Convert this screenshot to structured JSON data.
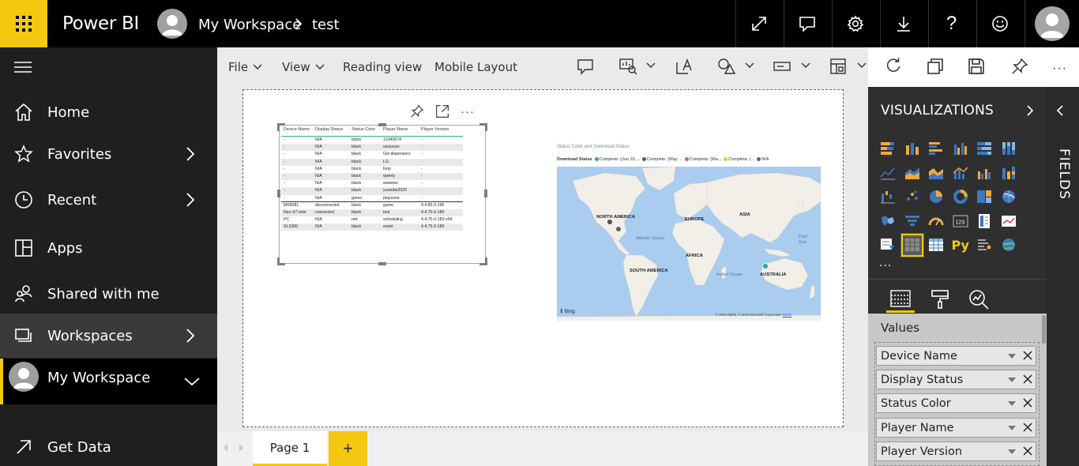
{
  "app": {
    "title": "Power BI",
    "accent": "#f2c811"
  },
  "breadcrumb": {
    "workspace": "My Workspace",
    "report": "test"
  },
  "header_icons": [
    "expand-icon",
    "comment-icon",
    "gear-icon",
    "download-icon",
    "help-icon",
    "smiley-icon",
    "user-avatar"
  ],
  "sidebar": {
    "items": [
      {
        "label": "Home",
        "icon": "home-icon"
      },
      {
        "label": "Favorites",
        "icon": "star-icon"
      },
      {
        "label": "Recent",
        "icon": "clock-icon"
      },
      {
        "label": "Apps",
        "icon": "apps-icon"
      },
      {
        "label": "Shared with me",
        "icon": "shared-icon"
      },
      {
        "label": "Workspaces",
        "icon": "workspaces-icon"
      },
      {
        "label": "My Workspace",
        "icon": "avatar"
      },
      {
        "label": "Get Data",
        "icon": "arrow-icon"
      }
    ]
  },
  "toolbar": {
    "file": "File",
    "view": "View",
    "reading_view": "Reading view",
    "mobile_layout": "Mobile Layout"
  },
  "table": {
    "columns": [
      "Device Name",
      "Display Status",
      "Status Color",
      "Player Name",
      "Player Version"
    ],
    "rows": [
      [
        "-",
        "N/A",
        "black",
        "12345678",
        "-"
      ],
      [
        "-",
        "N/A",
        "black",
        "ssssssss",
        "-"
      ],
      [
        "-",
        "N/A",
        "black",
        "Gel dispensers",
        "-"
      ],
      [
        "-",
        "N/A",
        "black",
        "LG",
        "-"
      ],
      [
        "-",
        "N/A",
        "black",
        "loop",
        "-"
      ],
      [
        "-",
        "N/A",
        "black",
        "qwerty",
        "-"
      ],
      [
        "-",
        "N/A",
        "black",
        "wwwww",
        "-"
      ],
      [
        "-",
        "N/A",
        "black",
        "youtube2020",
        "-"
      ],
      [
        "-",
        "N/A",
        "green",
        "playzone",
        "-"
      ],
      [
        "MK8081",
        "disconnected",
        "black",
        "game",
        "4.4.85-0-190"
      ],
      [
        "Nex-X7-mini",
        "connected",
        "black",
        "test",
        "4.4.75-0-180"
      ],
      [
        "PC",
        "N/A",
        "red",
        "scheduling",
        "4.4.75-0-183-x64"
      ],
      [
        "SL1066",
        "N/A",
        "black",
        "event",
        "4.4.75-0-180"
      ]
    ]
  },
  "map": {
    "title": "Status Color and Download Status",
    "legend_title": "Download Status",
    "legend": [
      {
        "label": "Complete: (Jun 19,...",
        "color": "#2aa99a"
      },
      {
        "label": "Complete: (May ...",
        "color": "#555555"
      },
      {
        "label": "Complete: (Ma...",
        "color": "#e8604c"
      },
      {
        "label": "Complete: (...",
        "color": "#e8c22b"
      },
      {
        "label": "N/A",
        "color": "#666666"
      }
    ],
    "continents": [
      "NORTH AMERICA",
      "EUROPE",
      "ASIA",
      "AFRICA",
      "SOUTH AMERICA",
      "AUSTRALIA"
    ],
    "oceans": [
      "Atlantic Ocean",
      "Indian Ocean",
      "Paci Oce"
    ],
    "brand": "Bing",
    "copyright": "© 2019 HERE, © 2019 Microsoft Corporation",
    "terms": "Terms"
  },
  "pages": {
    "tab": "Page 1",
    "add": "+"
  },
  "visualizations": {
    "title": "VISUALIZATIONS",
    "more": "...",
    "py_label": "Py",
    "wells_label": "Values",
    "fields": [
      "Device Name",
      "Display Status",
      "Status Color",
      "Player Name",
      "Player Version"
    ]
  },
  "fields_pane": {
    "title": "FIELDS"
  }
}
